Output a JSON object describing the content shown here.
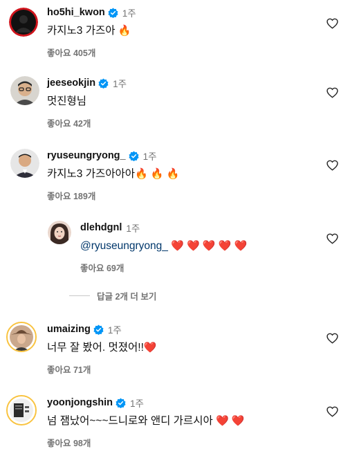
{
  "comments": [
    {
      "username": "ho5hi_kwon",
      "time": "1주",
      "text": "카지노3 가즈아",
      "emoji": "🔥",
      "likes": "좋아요 405개",
      "avatar": "black-silhouette-avatar"
    },
    {
      "username": "jeeseokjin",
      "time": "1주",
      "text": "멋진형님",
      "emoji": "",
      "likes": "좋아요 42개",
      "avatar": "man-with-glasses-avatar"
    },
    {
      "username": "ryuseungryong_",
      "time": "1주",
      "text": "카지노3  가즈아아아",
      "emoji": "🔥 🔥 🔥",
      "likes": "좋아요 189개",
      "avatar": "man-in-suit-avatar"
    }
  ],
  "reply": {
    "username": "dlehdgnl",
    "time": "1주",
    "mention": "@ryuseungryong_",
    "emoji": "❤️ ❤️ ❤️ ❤️ ❤️",
    "likes": "좋아요 69개",
    "avatar": "woman-avatar"
  },
  "view_replies_label": "답글 2개 더 보기",
  "comments2": [
    {
      "username": "umaizing",
      "time": "1주",
      "text": "너무 잘 봤어. 멋졌어!!",
      "emoji": "❤️",
      "likes": "좋아요 71개",
      "avatar": "woman-with-hat-avatar"
    },
    {
      "username": "yoonjongshin",
      "time": "1주",
      "text": "넘 잼났어~~~드니로와 앤디 가르시아",
      "emoji": "❤️ ❤️",
      "likes": "좋아요 98개",
      "avatar": "album-cover-avatar"
    }
  ],
  "colors": {
    "verified": "#0095f6",
    "mention": "#00376b",
    "secondary_text": "#737373",
    "story_ring": "#f9c33f"
  }
}
